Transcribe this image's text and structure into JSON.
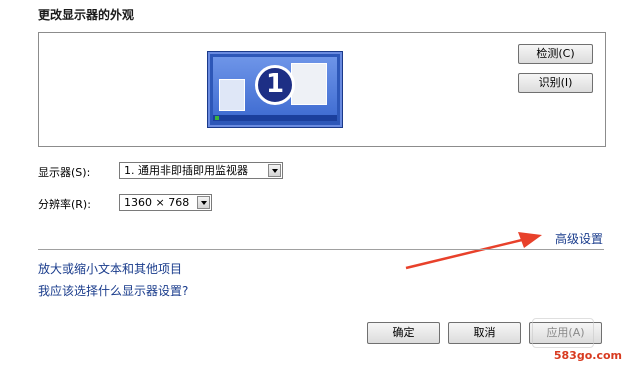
{
  "title": "更改显示器的外观",
  "preview": {
    "monitor_number": "1",
    "detect_label": "检测(C)",
    "identify_label": "识别(I)"
  },
  "form": {
    "display_label": "显示器(S):",
    "display_value": "1. 通用非即插即用监视器",
    "resolution_label": "分辨率(R):",
    "resolution_value": "1360 × 768"
  },
  "links": {
    "advanced": "高级设置",
    "enlarge_text": "放大或缩小文本和其他项目",
    "which_settings": "我应该选择什么显示器设置?"
  },
  "buttons": {
    "ok": "确定",
    "cancel": "取消",
    "apply": "应用(A)"
  },
  "annotation": {
    "arrow_color": "#e8412b"
  },
  "watermark": "583go.com"
}
